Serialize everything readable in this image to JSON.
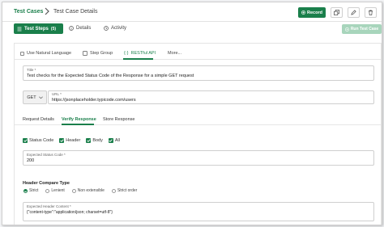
{
  "breadcrumb": {
    "root": "Test Cases",
    "current": "Test Case Details"
  },
  "toolbar": {
    "record_label": "Record"
  },
  "tabs": [
    {
      "label": "Test Steps",
      "count": "(5)"
    },
    {
      "label": "Details"
    },
    {
      "label": "Activity"
    }
  ],
  "run_button_label": "Run Test Case",
  "modes": {
    "natural_language": "Use Natural Language",
    "step_group": "Step Group",
    "restful_api": "RESTful API",
    "more": "More..."
  },
  "title_field": {
    "label": "Title *",
    "value": "Test checks for the Expected Status Code of the Response for a simple GET request"
  },
  "method": "GET",
  "url_field": {
    "label": "URL *",
    "value": "https://jsonplaceholder.typicode.com/users"
  },
  "subtabs": {
    "request_details": "Request Details",
    "verify_response": "Verify Response",
    "store_response": "Store Response"
  },
  "verify_checks": [
    {
      "label": "Status Code",
      "checked": true
    },
    {
      "label": "Header",
      "checked": true
    },
    {
      "label": "Body",
      "checked": true
    },
    {
      "label": "All",
      "checked": true
    }
  ],
  "expected_status": {
    "label": "Expected Status Code *",
    "value": "200"
  },
  "header_compare": {
    "title": "Header Compare Type",
    "options": [
      "Strict",
      "Lenient",
      "Non extensible",
      "Strict order"
    ],
    "selected": "Strict"
  },
  "expected_header": {
    "label": "Expected Header Content *",
    "value": "{\"content-type\":\"application/json; charset=utf-8\"}"
  },
  "colors": {
    "primary": "#1a7f4b",
    "disabled": "#a8d5bc"
  }
}
